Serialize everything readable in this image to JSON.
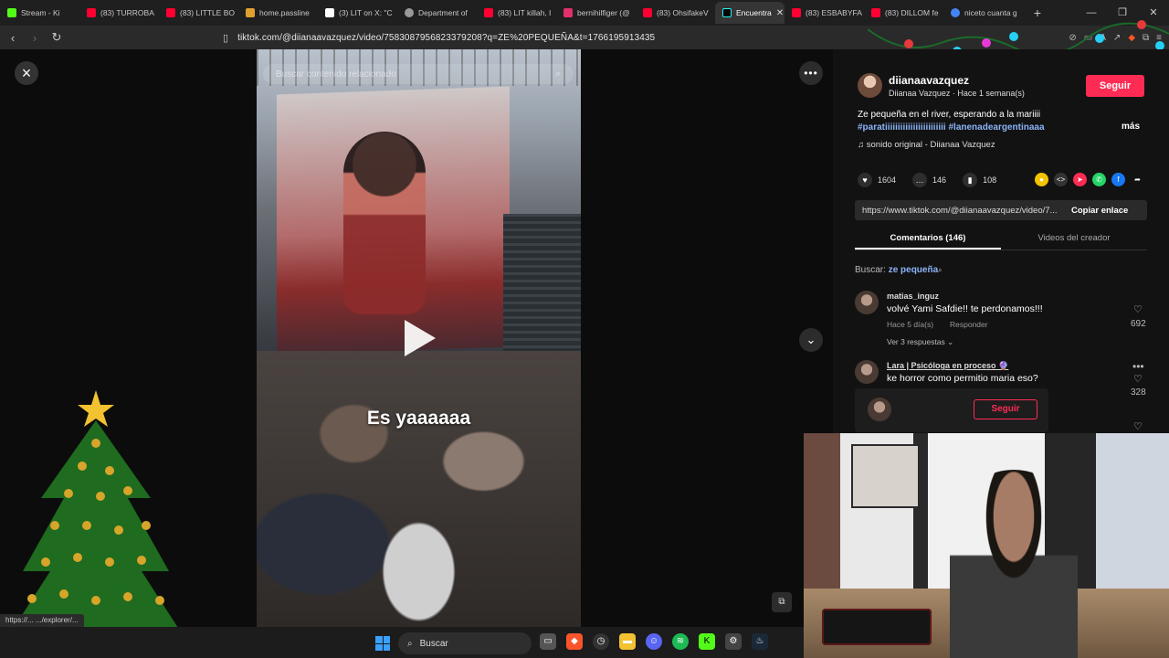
{
  "browser": {
    "tabs": [
      {
        "label": "Stream - Ki",
        "color": "#53fc18"
      },
      {
        "label": "(83) TURROBA",
        "color": "#ff0033"
      },
      {
        "label": "(83) LITTLE BO",
        "color": "#ff0033"
      },
      {
        "label": "home.passline",
        "color": "#e0a030"
      },
      {
        "label": "(3) LIT on X: \"C",
        "color": "#ffffff"
      },
      {
        "label": "Department of",
        "color": "#999999"
      },
      {
        "label": "(83) LIT killah, I",
        "color": "#ff0033"
      },
      {
        "label": "bernihilfiger (@",
        "color": "#e1306c"
      },
      {
        "label": "(83) OhsifakeV",
        "color": "#ff0033"
      },
      {
        "label": "Encuentra",
        "color": "#000000",
        "active": true
      },
      {
        "label": "(83) ESBABYFA",
        "color": "#ff0033"
      },
      {
        "label": "(83) DILLOM fe",
        "color": "#ff0033"
      },
      {
        "label": "niceto cuanta g",
        "color": "#4285f4"
      }
    ],
    "new_tab": "+",
    "url": "tiktok.com/@diianaavazquez/video/7583087956823379208?q=ZE%20PEQUEÑA&t=1766195913435",
    "status_url": "https://... .../explorer/..."
  },
  "video": {
    "search_placeholder": "Buscar contenido relacionado",
    "caption": "Es yaaaaaa",
    "close_icon": "×",
    "more_icon": "•••",
    "down_icon": "⌄"
  },
  "post": {
    "username": "diianaavazquez",
    "subline": "Diianaa Vazquez · Hace 1 semana(s)",
    "follow_label": "Seguir",
    "description": "Ze pequeña en el river, esperando a la mariiii",
    "hashtags": "#paratiiiiiiiiiiiiiiiiiiiiiiii #lanenadeargentinaaa",
    "more_label": "más",
    "sound": "sonido original - Diianaa Vazquez",
    "likes": "1604",
    "comments": "146",
    "saves": "108",
    "link": "https://www.tiktok.com/@diianaavazquez/video/7...",
    "copy_label": "Copiar enlace",
    "tab_comments": "Comentarios (146)",
    "tab_creator": "Videos del creador",
    "search_prefix": "Buscar:",
    "search_term": "ze pequeña"
  },
  "comments": [
    {
      "user": "matias_inguz",
      "text": "volvé Yami Safdie!! te perdonamos!!!",
      "meta": "Hace 5 día(s)",
      "reply": "Responder",
      "replies": "Ver 3 respuestas",
      "likes": "692"
    },
    {
      "user": "Lara | Psicóloga en proceso 🔮",
      "text": "ke horror como permitio maria eso?",
      "likes": "328"
    }
  ],
  "hover_card": {
    "follow_label": "Seguir"
  },
  "taskbar": {
    "search_label": "Buscar"
  }
}
